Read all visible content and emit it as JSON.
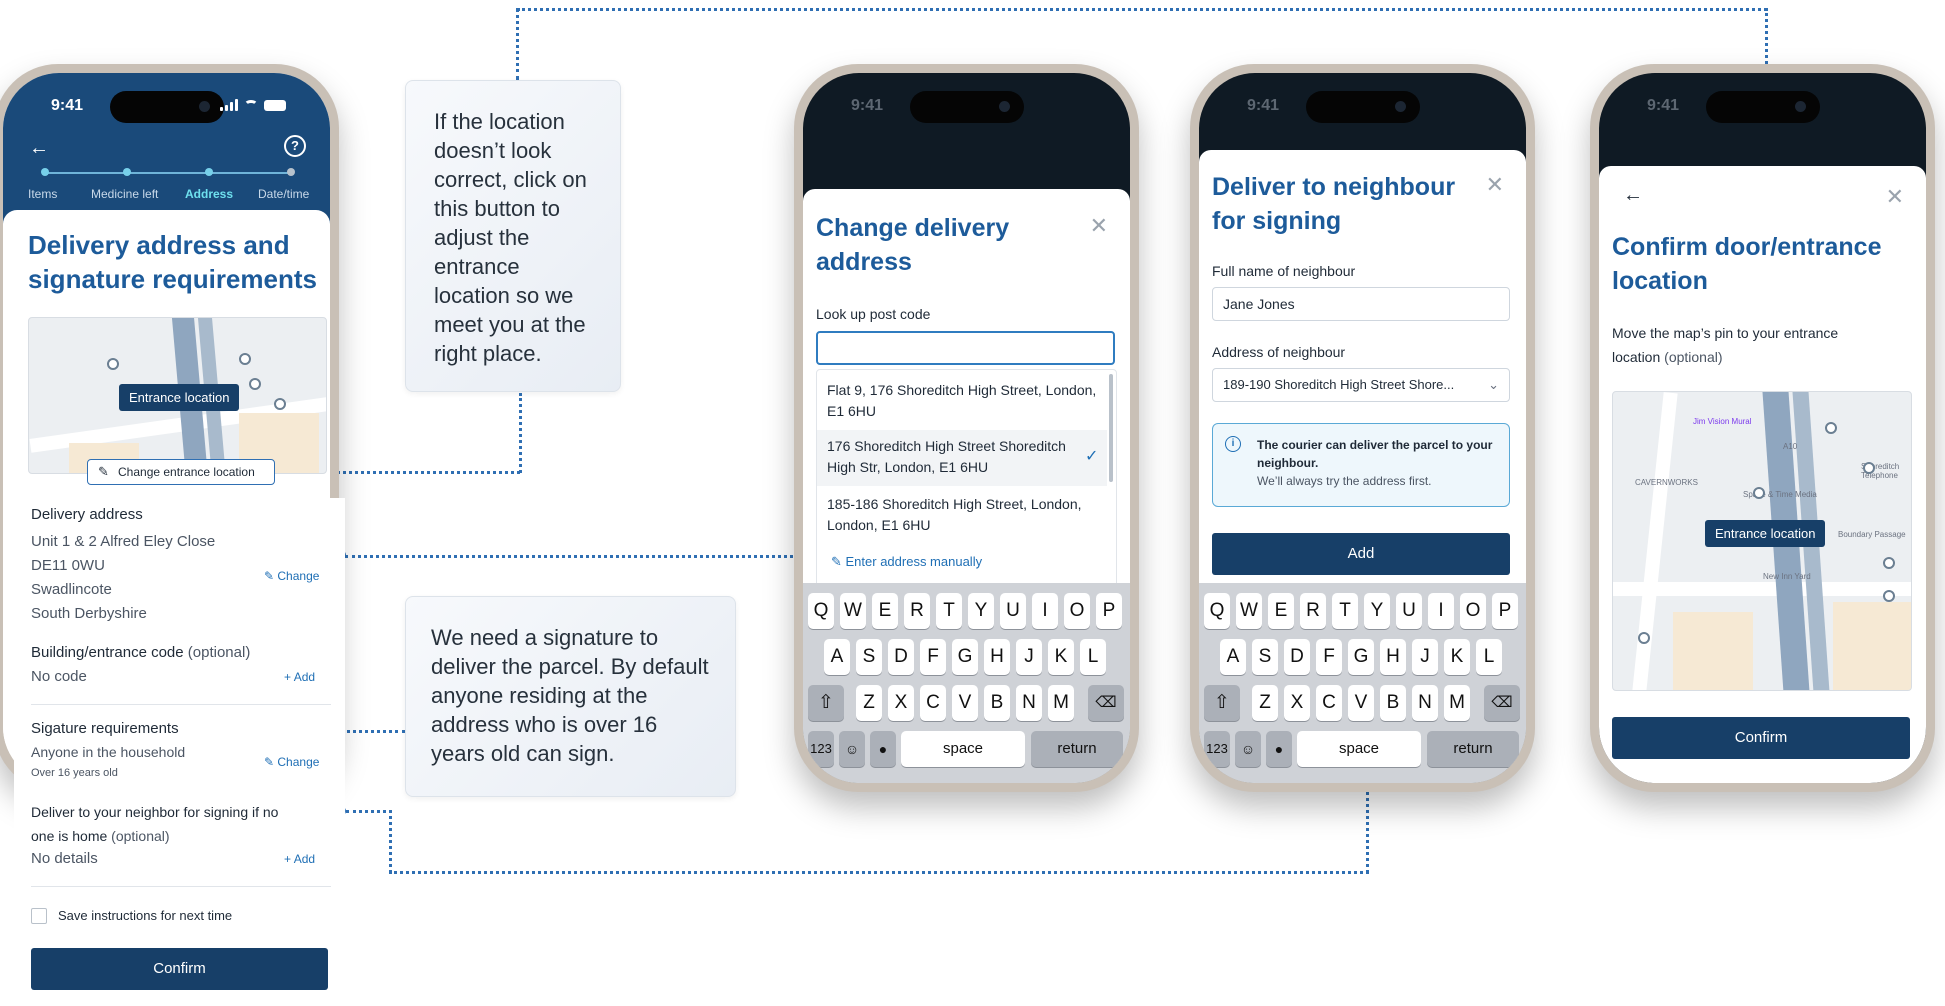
{
  "status": {
    "time": "9:41"
  },
  "phone1": {
    "steps": [
      "Items",
      "Medicine left",
      "Address",
      "Date/time"
    ],
    "active_step": "Address",
    "title_line1": "Delivery address and",
    "title_line2": "signature requirements",
    "map_tag": "Entrance location",
    "change_entrance": "Change entrance location",
    "delivery_address_label": "Delivery address",
    "address_lines": [
      "Unit 1 & 2 Alfred Eley Close",
      "DE11 0WU",
      "Swadlincote",
      "South Derbyshire"
    ],
    "change_label": "Change",
    "building_code_label": "Building/entrance code",
    "optional": "(optional)",
    "building_code_value": "No code",
    "add_label": "Add",
    "signature_label": "Sigature requirements",
    "signature_value": "Anyone in the household",
    "signature_sub": "Over 16 years old",
    "neighbour_label_line1": "Deliver to your neighbor for signing if no",
    "neighbour_label_line2": "one is home",
    "neighbour_value": "No details",
    "save_instructions": "Save instructions for next time",
    "confirm": "Confirm"
  },
  "tips": {
    "location": "If the location doesn’t look correct, click on this button to adjust the entrance location so we meet you at the right place.",
    "signature": "We need a signature to deliver the parcel. By default anyone residing at the address who is over 16 years old can sign."
  },
  "phone2": {
    "title_line1": "Change delivery",
    "title_line2": "address",
    "postcode_label": "Look up post code",
    "postcode_value": "",
    "results": [
      [
        "Flat 9, 176 Shoreditch High Street, London,",
        "E1 6HU"
      ],
      [
        "176 Shoreditch High Street Shoreditch",
        "High Str, London, E1 6HU"
      ],
      [
        "185-186 Shoreditch High Street, London,",
        "London, E1 6HU"
      ]
    ],
    "selected_index": 1,
    "manual": "Enter address manually"
  },
  "phone3": {
    "title_line1": "Deliver to neighbour",
    "title_line2": "for signing",
    "name_label": "Full name of neighbour",
    "name_value": "Jane Jones",
    "address_label": "Address of neighbour",
    "address_value": "189-190 Shoreditch High Street Shore...",
    "info_bold": "The courier can deliver the parcel to your neighbour.",
    "info_sub": "We’ll always try the address first.",
    "add_button": "Add"
  },
  "phone4": {
    "title_line1": "Confirm door/entrance",
    "title_line2": "location",
    "desc_line1": "Move the map’s pin to your entrance",
    "desc_line2": "location",
    "optional": "(optional)",
    "map_tag": "Entrance location",
    "map_labels": [
      "Jim Vision Mural",
      "CAVERNWORKS",
      "Space & Time Media",
      "Shoreditch Telephone",
      "Boundary Passage",
      "New Inn Yard",
      "A10"
    ],
    "confirm": "Confirm"
  },
  "keyboard": {
    "row1": [
      "Q",
      "W",
      "E",
      "R",
      "T",
      "Y",
      "U",
      "I",
      "O",
      "P"
    ],
    "row2": [
      "A",
      "S",
      "D",
      "F",
      "G",
      "H",
      "J",
      "K",
      "L"
    ],
    "row3": [
      "Z",
      "X",
      "C",
      "V",
      "B",
      "N",
      "M"
    ],
    "num": "123",
    "space": "space",
    "return": "return"
  },
  "colors": {
    "primary": "#173f68",
    "header": "#1a4a7a",
    "title": "#1d5b9a",
    "connector": "#2f6fb3"
  }
}
